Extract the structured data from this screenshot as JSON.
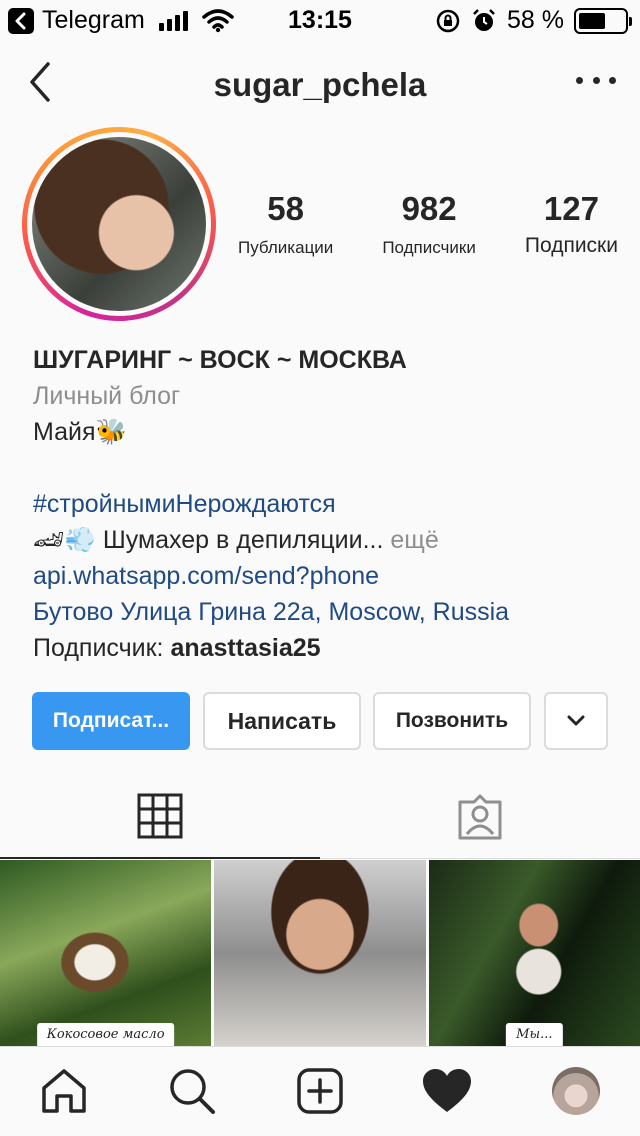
{
  "status_bar": {
    "back_app": "Telegram",
    "time": "13:15",
    "battery_percent": "58 %",
    "battery_level": 0.58,
    "icons": [
      "back-arrow-icon",
      "signal-icon",
      "wifi-icon",
      "rotation-lock-icon",
      "alarm-icon",
      "battery-icon"
    ]
  },
  "header": {
    "username": "sugar_pchela",
    "back_icon": "chevron-left-icon",
    "more_icon": "more-horizontal-icon"
  },
  "stats": [
    {
      "value": "58",
      "label": "Публикации"
    },
    {
      "value": "982",
      "label": "Подписчики"
    },
    {
      "value": "127",
      "label": "Подписки"
    }
  ],
  "bio": {
    "name": "ШУГАРИНГ ~ ВОСК ~ МОСКВА",
    "category": "Личный блог",
    "line1": "Майя🐝",
    "hashtag": "#стройнымиНерождаются",
    "line2_emoji": "🏎💨",
    "line2_text": " Шумахер в депиляции...",
    "more": " ещё",
    "link": "api.whatsapp.com/send?phone",
    "address": "Бутово Улица Грина 22а, Moscow, Russia",
    "follower_prefix": "Подписчик: ",
    "follower_name": "anasttasia25"
  },
  "actions": {
    "follow": "Подписат...",
    "message": "Написать",
    "call": "Позвонить",
    "dropdown_icon": "chevron-down-icon"
  },
  "tabs": [
    {
      "name": "grid",
      "icon": "grid-icon",
      "active": true
    },
    {
      "name": "tagged",
      "icon": "tagged-person-icon",
      "active": false
    }
  ],
  "posts": [
    {
      "caption": "Кокосовое масло"
    },
    {
      "caption": ""
    },
    {
      "caption": "Мы..."
    }
  ],
  "bottom_nav": [
    "home-icon",
    "search-icon",
    "add-icon",
    "heart-icon",
    "profile-avatar"
  ],
  "colors": {
    "accent": "#3897f0",
    "link": "#1f4a84",
    "muted": "#8e8e8e",
    "text": "#262626",
    "border": "#dbdbdb"
  }
}
